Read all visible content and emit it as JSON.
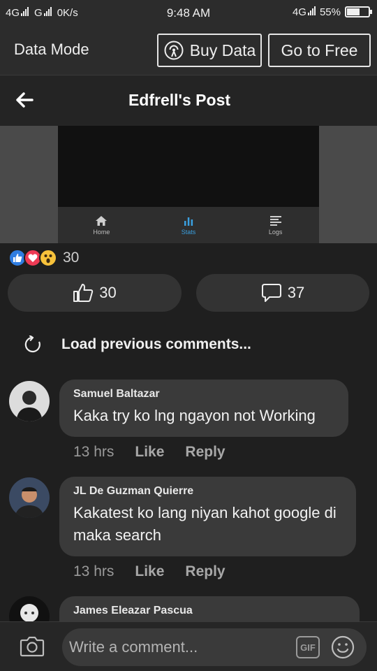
{
  "status_bar": {
    "network_left": "4G",
    "network_mid": "G",
    "speed": "0K/s",
    "time": "9:48 AM",
    "network_right": "4G",
    "battery": "55%",
    "battery_level": 0.55
  },
  "data_mode": {
    "title": "Data Mode",
    "buy_label": "Buy Data",
    "free_label": "Go to Free"
  },
  "header": {
    "title": "Edfrell's Post"
  },
  "post_image": {
    "nav": [
      {
        "label": "Home",
        "icon": "home-icon"
      },
      {
        "label": "Stats",
        "icon": "bar-chart-icon"
      },
      {
        "label": "Logs",
        "icon": "list-icon"
      }
    ]
  },
  "reactions": {
    "count": "30",
    "types": [
      "like",
      "love",
      "wow"
    ]
  },
  "actions": {
    "likes": "30",
    "comments": "37"
  },
  "load_previous": "Load previous comments...",
  "comments": [
    {
      "author": "Samuel Baltazar",
      "text": "Kaka try ko lng ngayon not Working",
      "time": "13 hrs",
      "like": "Like",
      "reply": "Reply"
    },
    {
      "author": "JL De Guzman Quierre",
      "text": "Kakatest ko lang niyan kahot google di maka search",
      "time": "13 hrs",
      "like": "Like",
      "reply": "Reply"
    },
    {
      "author": "James Eleazar Pascua"
    }
  ],
  "composer": {
    "placeholder": "Write a comment...",
    "gif": "GIF"
  },
  "colors": {
    "accent_blue": "#2f7de1",
    "love_red": "#ee3b55",
    "wow_yellow": "#f7c23b",
    "background": "#1f1f1f"
  }
}
